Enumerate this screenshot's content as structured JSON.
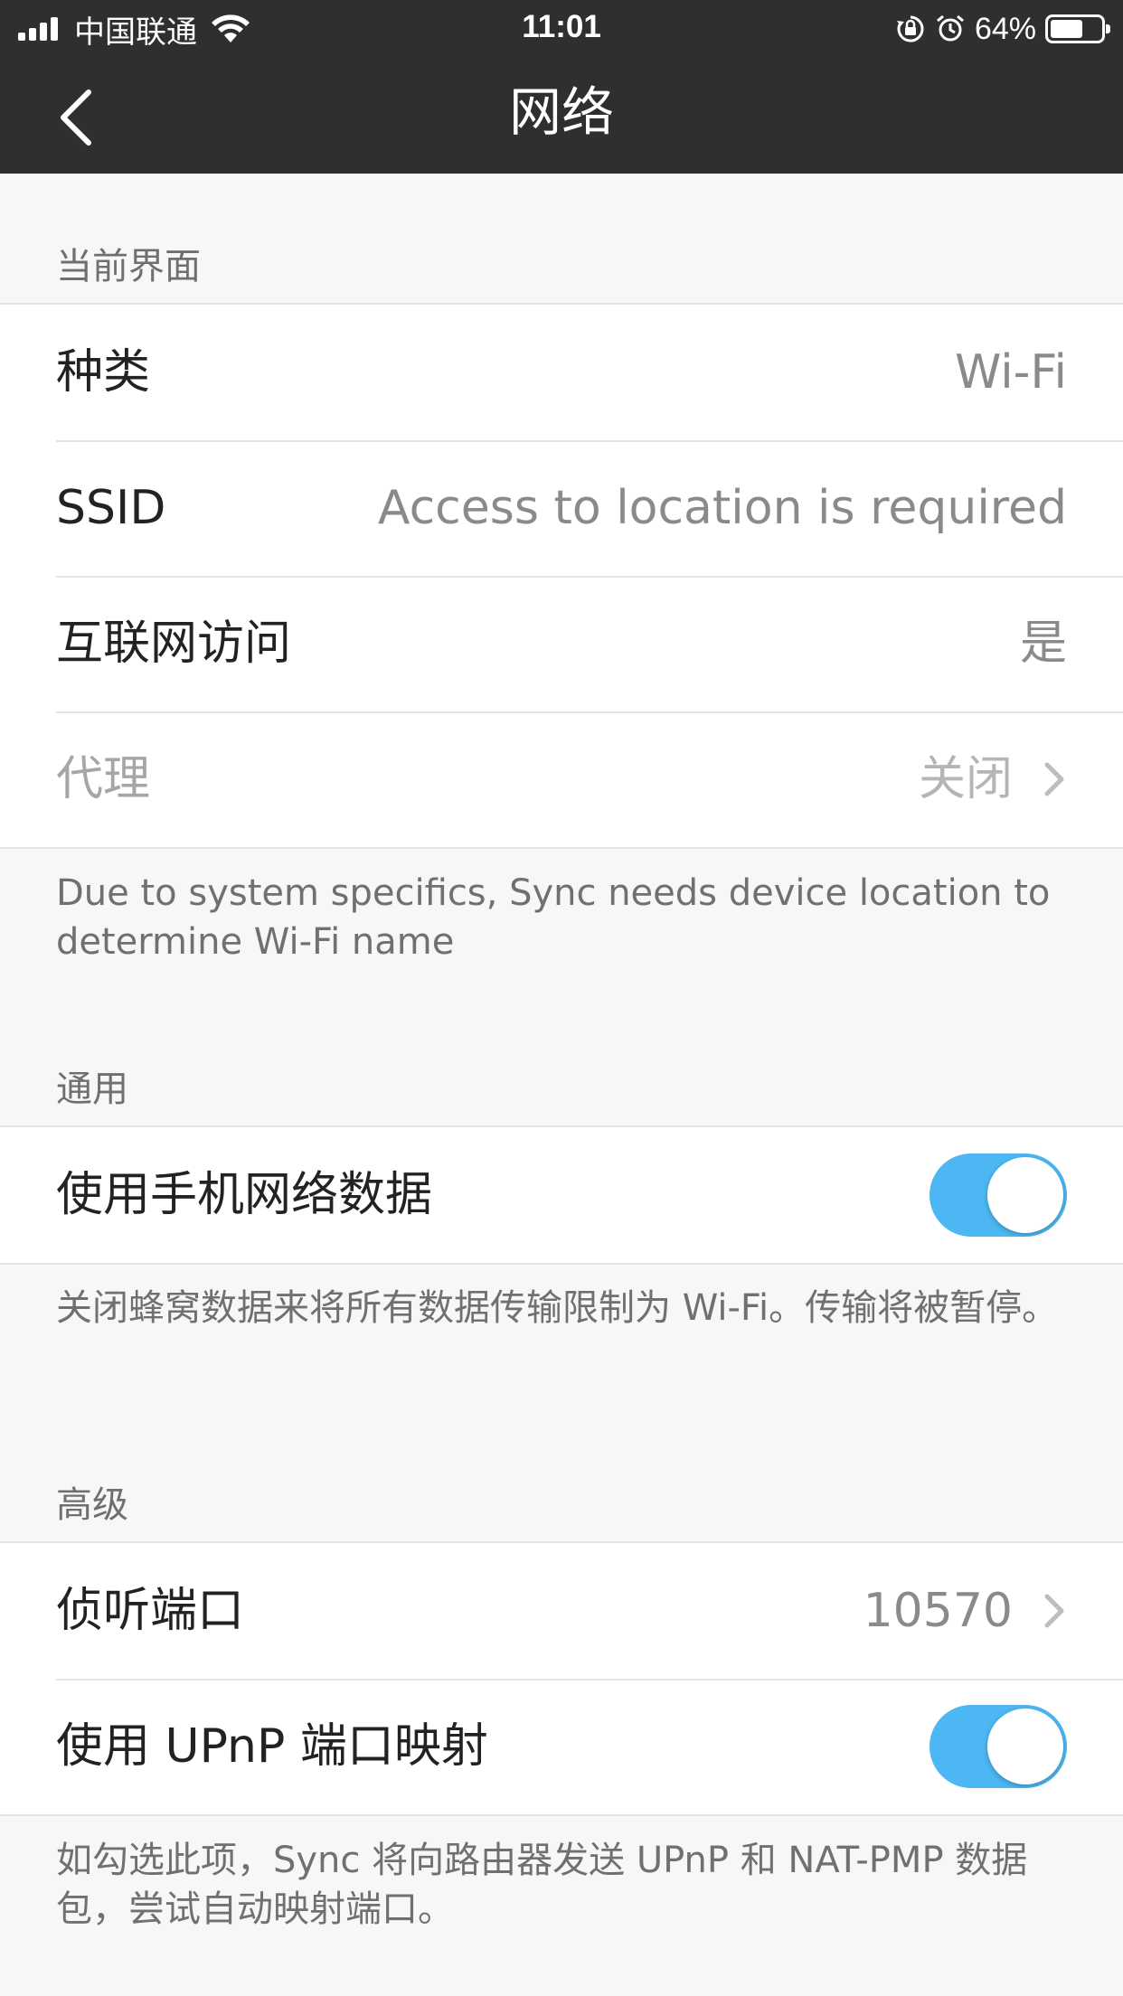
{
  "status_bar": {
    "carrier": "中国联通",
    "time": "11:01",
    "battery_percent": "64%",
    "battery_level": 0.64,
    "icons": [
      "signal-icon",
      "wifi-icon",
      "orientation-lock-icon",
      "alarm-icon",
      "battery-icon"
    ]
  },
  "nav": {
    "title": "网络",
    "back_icon": "chevron-left-icon"
  },
  "current_interface": {
    "header": "当前界面",
    "rows": [
      {
        "label": "种类",
        "value": "Wi-Fi"
      },
      {
        "label": "SSID",
        "value": "Access to location is required"
      },
      {
        "label": "互联网访问",
        "value": "是"
      },
      {
        "label": "代理",
        "value": "关闭"
      }
    ],
    "footnote": "Due to system specifics, Sync needs device location to determine Wi-Fi name"
  },
  "general": {
    "header": "通用",
    "mobile_data": {
      "label": "使用手机网络数据",
      "enabled": true
    },
    "footnote": "关闭蜂窝数据来将所有数据传输限制为 Wi-Fi。传输将被暂停。"
  },
  "advanced": {
    "header": "高级",
    "listen_port": {
      "label": "侦听端口",
      "value": "10570"
    },
    "upnp": {
      "label": "使用 UPnP 端口映射",
      "enabled": true
    },
    "footnote": "如勾选此项，Sync 将向路由器发送 UPnP 和 NAT-PMP 数据包，尝试自动映射端口。"
  },
  "colors": {
    "bar_background": "#2f2f2f",
    "page_background": "#f7f7f7",
    "toggle_on": "#4cb7f2",
    "value_text": "#8a8a8a"
  }
}
